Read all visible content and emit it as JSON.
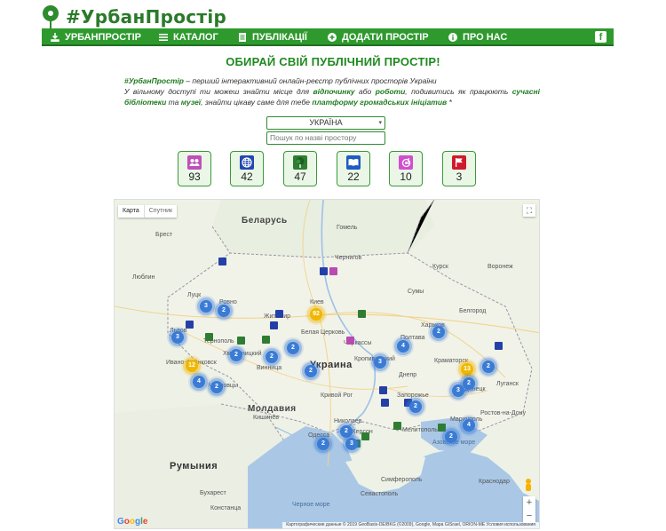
{
  "header": {
    "logo_text": "#УрбанПростір",
    "facebook_label": "f"
  },
  "nav": [
    {
      "label": "УРБАНПРОСТІР",
      "icon": "download-icon"
    },
    {
      "label": "КАТАЛОГ",
      "icon": "list-icon"
    },
    {
      "label": "ПУБЛІКАЦІЇ",
      "icon": "document-icon"
    },
    {
      "label": "ДОДАТИ ПРОСТІР",
      "icon": "plus-circle-icon"
    },
    {
      "label": "ПРО НАС",
      "icon": "info-icon"
    }
  ],
  "page": {
    "title": "ОБИРАЙ СВІЙ ПУБЛІЧНИЙ ПРОСТІР!",
    "intro_brand": "#УрбанПростір",
    "intro_line1": " – перший інтерактивний онлайн-реєстр публічних просторів України",
    "intro_p2a": "У вільному доступі ти можеш знайти місце для ",
    "intro_b1": "відпочинку",
    "intro_p2b": " або ",
    "intro_b2": "роботи",
    "intro_p2c": ", подивитись як працюють ",
    "intro_b3": "сучасні бібліотеки",
    "intro_p2d": " та ",
    "intro_b4": "музеї",
    "intro_p2e": ", знайти цікаву саме для тебе ",
    "intro_b5": "платформу громадських ініціатив",
    "intro_p2f": " *"
  },
  "filters": {
    "country_selected": "УКРАЇНА",
    "search_placeholder": "Пошук по назві простору"
  },
  "categories": [
    {
      "icon": "community-icon",
      "count": "93",
      "color": "#c04fb9"
    },
    {
      "icon": "globe-icon",
      "count": "42",
      "color": "#2448b0"
    },
    {
      "icon": "tree-icon",
      "count": "47",
      "color": "#2e7d32"
    },
    {
      "icon": "book-icon",
      "count": "22",
      "color": "#1e5bc4"
    },
    {
      "icon": "art-icon",
      "count": "10",
      "color": "#d24ed0"
    },
    {
      "icon": "flag-icon",
      "count": "3",
      "color": "#d01b2c"
    }
  ],
  "map": {
    "toggle_map": "Карта",
    "toggle_sat": "Спутник",
    "zoom_in": "+",
    "zoom_out": "−",
    "google": "Google",
    "attribution": "Картографические данные © 2019 GeoBasis-DE/BKG (©2009), Google, Mapa GISrael, ORION-ME   Условия использования",
    "labels": {
      "belarus": "Беларусь",
      "ukraine": "Украина",
      "moldova": "Молдавия",
      "romania": "Румыния",
      "kiev": "Киев",
      "lublin": "Люблин",
      "lviv": "Львов",
      "kharkov": "Харьков",
      "voronezh": "Воронеж",
      "kursk": "Курск",
      "dnipro": "Днепр",
      "zaporozhye": "Запорожье",
      "odessa": "Одесса",
      "kishinev": "Кишинёв",
      "sevastopol": "Севастополь",
      "rostov": "Ростов-на-Дону",
      "krasnodar": "Краснодар",
      "bucharest": "Бухарест",
      "mariupol": "Мариуполь",
      "lugansk": "Луганск",
      "donetsk": "Донецк",
      "poltava": "Полтава",
      "nikolaev": "Николаев",
      "kherson": "Херсон",
      "krivoy_rog": "Кривой Рог",
      "zhitomir": "Житомир",
      "chernigov": "Чернигов",
      "sumy": "Сумы",
      "belaya_tserkov": "Белая Церковь",
      "cherkassy": "Черкассы",
      "kropyvnytskyi": "Кропивницкий",
      "khmelnitsky": "Хмельницкий",
      "ternopil": "Тернополь",
      "ivano_frankivsk": "Ивано-Франковск",
      "chernivtsi": "Черновцы",
      "rovno": "Ровно",
      "lutsk": "Луцк",
      "vinnytsia": "Винница",
      "brest": "Брест",
      "gomel": "Гомель",
      "belgorod": "Белгород",
      "kramatorsk": "Краматорск",
      "melitopol": "Мелитополь",
      "simferopol": "Симферополь",
      "constanta": "Констанца",
      "black_sea": "Черное море",
      "azov": "Азовское море"
    },
    "clusters": [
      {
        "n": "3",
        "color": "blue"
      },
      {
        "n": "2",
        "color": "blue"
      },
      {
        "n": "92",
        "color": "yellow"
      },
      {
        "n": "3",
        "color": "blue"
      },
      {
        "n": "12",
        "color": "yellow"
      },
      {
        "n": "4",
        "color": "blue"
      },
      {
        "n": "2",
        "color": "blue"
      },
      {
        "n": "2",
        "color": "blue"
      },
      {
        "n": "2",
        "color": "blue"
      },
      {
        "n": "4",
        "color": "blue"
      },
      {
        "n": "3",
        "color": "blue"
      },
      {
        "n": "2",
        "color": "blue"
      },
      {
        "n": "13",
        "color": "yellow"
      },
      {
        "n": "2",
        "color": "blue"
      },
      {
        "n": "2",
        "color": "blue"
      },
      {
        "n": "3",
        "color": "blue"
      },
      {
        "n": "4",
        "color": "blue"
      },
      {
        "n": "2",
        "color": "blue"
      },
      {
        "n": "2",
        "color": "blue"
      },
      {
        "n": "2",
        "color": "blue"
      },
      {
        "n": "2",
        "color": "blue"
      },
      {
        "n": "3",
        "color": "blue"
      },
      {
        "n": "2",
        "color": "blue"
      },
      {
        "n": "2",
        "color": "blue"
      }
    ]
  }
}
